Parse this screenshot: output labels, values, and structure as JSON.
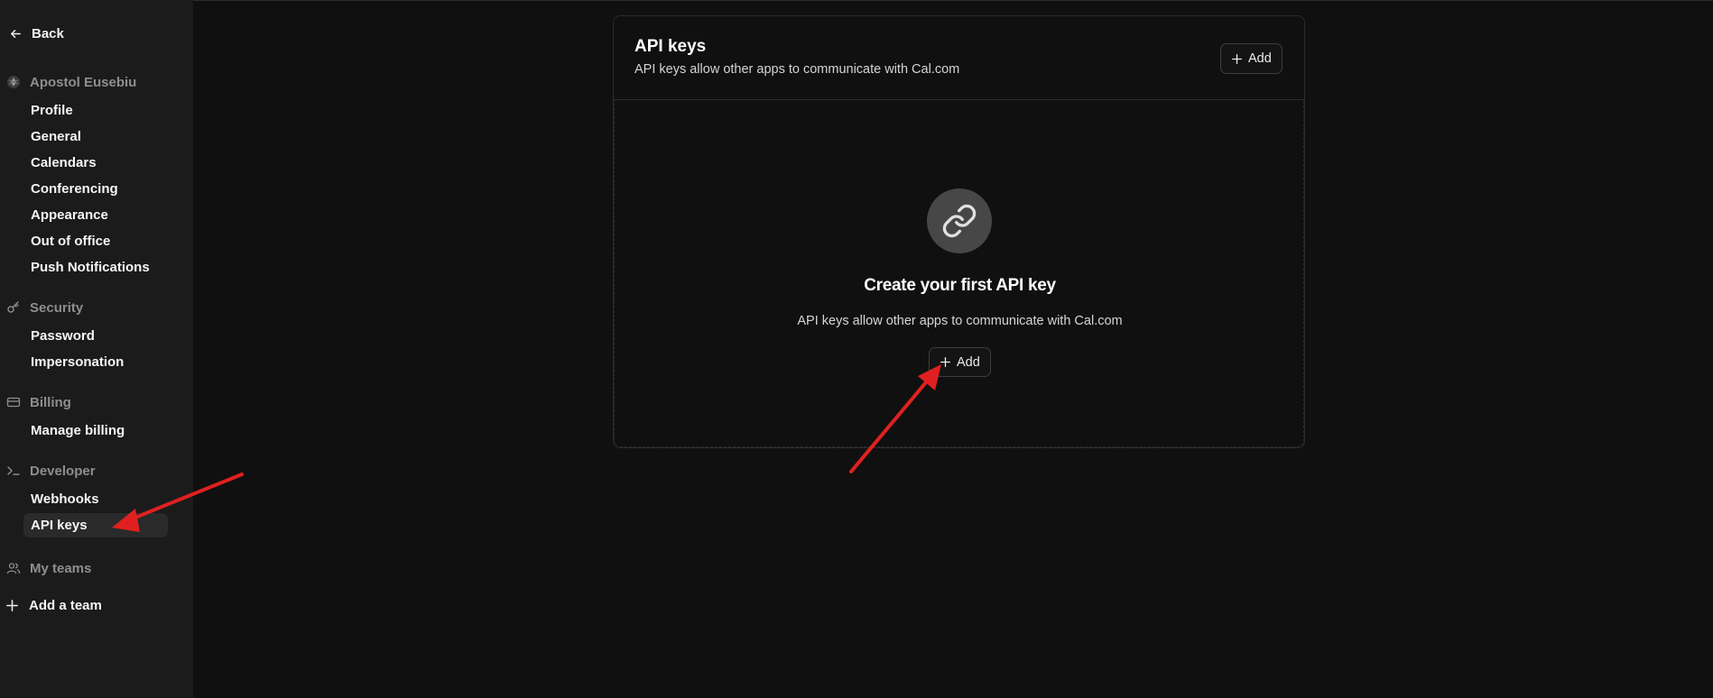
{
  "sidebar": {
    "back_label": "Back",
    "account": {
      "name": "Apostol Eusebiu",
      "icon": "avatar-icon"
    },
    "account_items": [
      {
        "label": "Profile"
      },
      {
        "label": "General"
      },
      {
        "label": "Calendars"
      },
      {
        "label": "Conferencing"
      },
      {
        "label": "Appearance"
      },
      {
        "label": "Out of office"
      },
      {
        "label": "Push Notifications"
      }
    ],
    "security": {
      "title": "Security",
      "icon": "key-icon",
      "items": [
        {
          "label": "Password"
        },
        {
          "label": "Impersonation"
        }
      ]
    },
    "billing": {
      "title": "Billing",
      "icon": "credit-card-icon",
      "items": [
        {
          "label": "Manage billing"
        }
      ]
    },
    "developer": {
      "title": "Developer",
      "icon": "terminal-icon",
      "items": [
        {
          "label": "Webhooks"
        },
        {
          "label": "API keys",
          "active": true
        }
      ]
    },
    "teams": {
      "title": "My teams",
      "icon": "users-icon"
    },
    "add_team_label": "Add a team"
  },
  "main": {
    "title": "API keys",
    "subtitle": "API keys allow other apps to communicate with Cal.com",
    "add_button_label": "Add",
    "empty_state": {
      "icon": "link-icon",
      "title": "Create your first API key",
      "description": "API keys allow other apps to communicate with Cal.com",
      "add_button_label": "Add"
    }
  },
  "colors": {
    "background": "#101010",
    "sidebar": "#1b1b1b",
    "active_item": "#2a2a2a",
    "annotation_arrow": "#e02020"
  }
}
